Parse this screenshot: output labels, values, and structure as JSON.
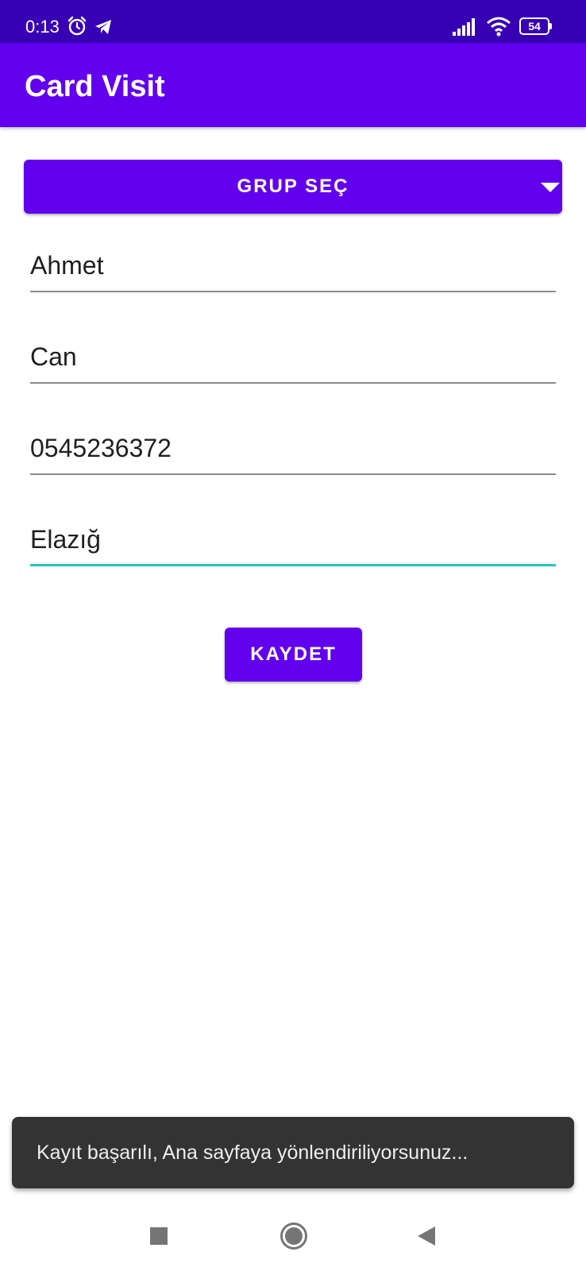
{
  "status_bar": {
    "time": "0:13",
    "battery": "54",
    "icons": [
      "alarm-icon",
      "telegram-icon",
      "signal-icon",
      "wifi-icon",
      "battery-icon"
    ]
  },
  "app_bar": {
    "title": "Card Visit"
  },
  "form": {
    "group_spinner_label": "GRUP SEÇ",
    "first_name": "Ahmet",
    "last_name": "Can",
    "phone": "0545236372",
    "city": "Elazığ",
    "save_label": "KAYDET"
  },
  "snackbar": {
    "message": "Kayıt başarılı, Ana sayfaya yönlendiriliyorsunuz..."
  },
  "nav_bar": {
    "icons": [
      "recents-icon",
      "home-icon",
      "back-icon"
    ]
  },
  "colors": {
    "status_bar": "#3700b3",
    "primary": "#6200ee",
    "focus_underline": "#26c6c0",
    "snackbar": "#333333"
  }
}
